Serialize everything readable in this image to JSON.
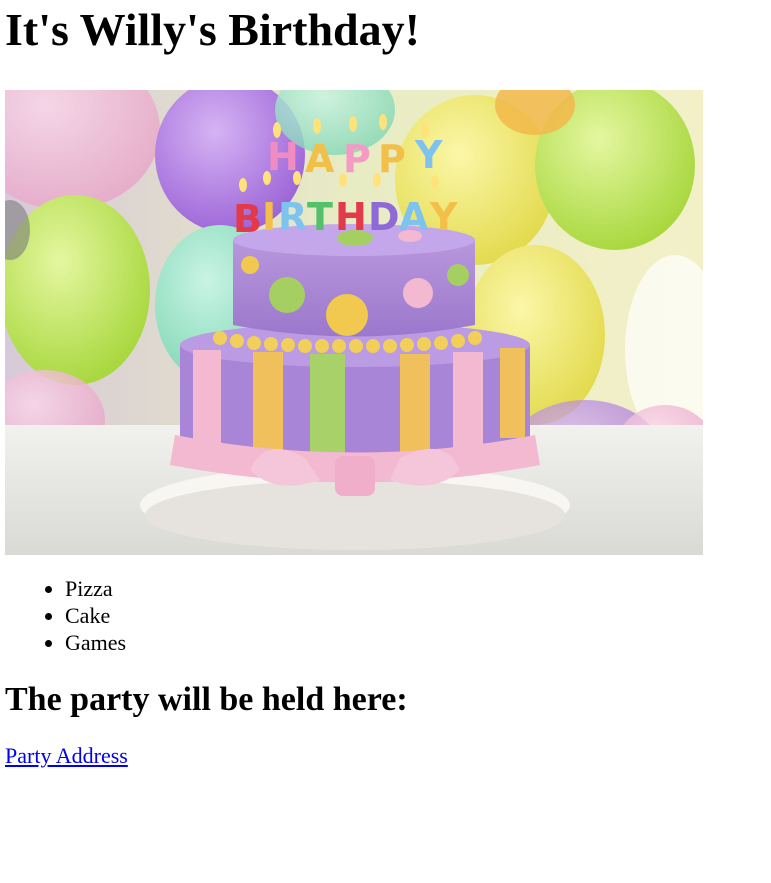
{
  "page": {
    "title": "It's Willy's Birthday!",
    "hero_image_alt": "Birthday cake with Happy Birthday candles and balloons",
    "menu_items": [
      "Pizza",
      "Cake",
      "Games"
    ],
    "location_heading": "The party will be held here:",
    "address_link_text": "Party Address"
  },
  "colors": {
    "link": "#0000ee",
    "text": "#000000",
    "background": "#ffffff"
  }
}
